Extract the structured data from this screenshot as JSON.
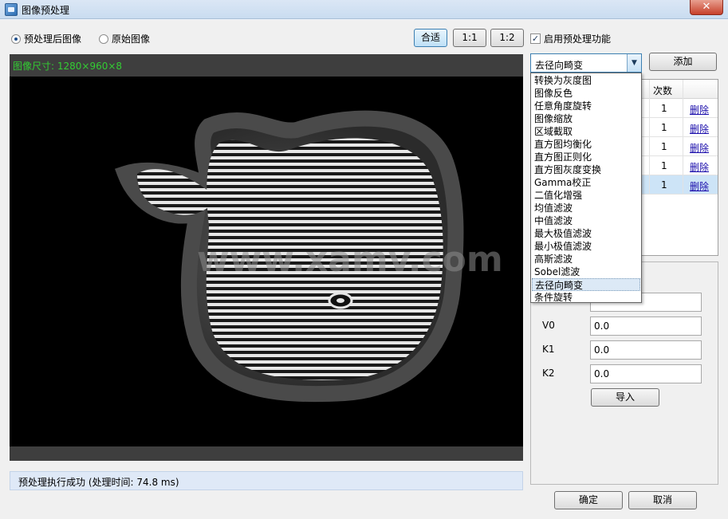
{
  "window": {
    "title": "图像预处理",
    "close_label": "✕"
  },
  "view_mode": {
    "processed_label": "预处理后图像",
    "original_label": "原始图像",
    "selected": "processed"
  },
  "zoom": {
    "fit_label": "合适",
    "one_to_one_label": "1:1",
    "one_to_two_label": "1:2"
  },
  "enable_preprocess": {
    "label": "启用预处理功能",
    "checked": true,
    "check_mark": "✓"
  },
  "viewer": {
    "size_label": "图像尺寸: 1280×960×8",
    "watermark": "www.xamv.com"
  },
  "status": {
    "text": "预处理执行成功 (处理时间: 74.8 ms)"
  },
  "operation_select": {
    "value": "去径向畸变",
    "arrow": "▼",
    "options": [
      "转换为灰度图",
      "图像反色",
      "任意角度旋转",
      "图像缩放",
      "区域截取",
      "直方图均衡化",
      "直方图正则化",
      "直方图灰度变换",
      "Gamma校正",
      "二值化增强",
      "均值滤波",
      "中值滤波",
      "最大极值滤波",
      "最小极值滤波",
      "高斯滤波",
      "Sobel滤波",
      "去径向畸变",
      "条件旋转"
    ],
    "highlighted_index": 16
  },
  "add_button": {
    "label": "添加"
  },
  "steps_table": {
    "count_header": "次数",
    "rows": [
      {
        "count": "1",
        "delete_label": "删除"
      },
      {
        "count": "1",
        "delete_label": "删除"
      },
      {
        "count": "1",
        "delete_label": "删除"
      },
      {
        "count": "1",
        "delete_label": "删除"
      },
      {
        "count": "1",
        "delete_label": "删除"
      }
    ],
    "selected_row": 4
  },
  "params": {
    "fields": [
      {
        "label": "",
        "value": ""
      },
      {
        "label": "V0",
        "value": "0.0"
      },
      {
        "label": "K1",
        "value": "0.0"
      },
      {
        "label": "K2",
        "value": "0.0"
      }
    ],
    "import_label": "导入"
  },
  "footer": {
    "ok_label": "确定",
    "cancel_label": "取消"
  }
}
